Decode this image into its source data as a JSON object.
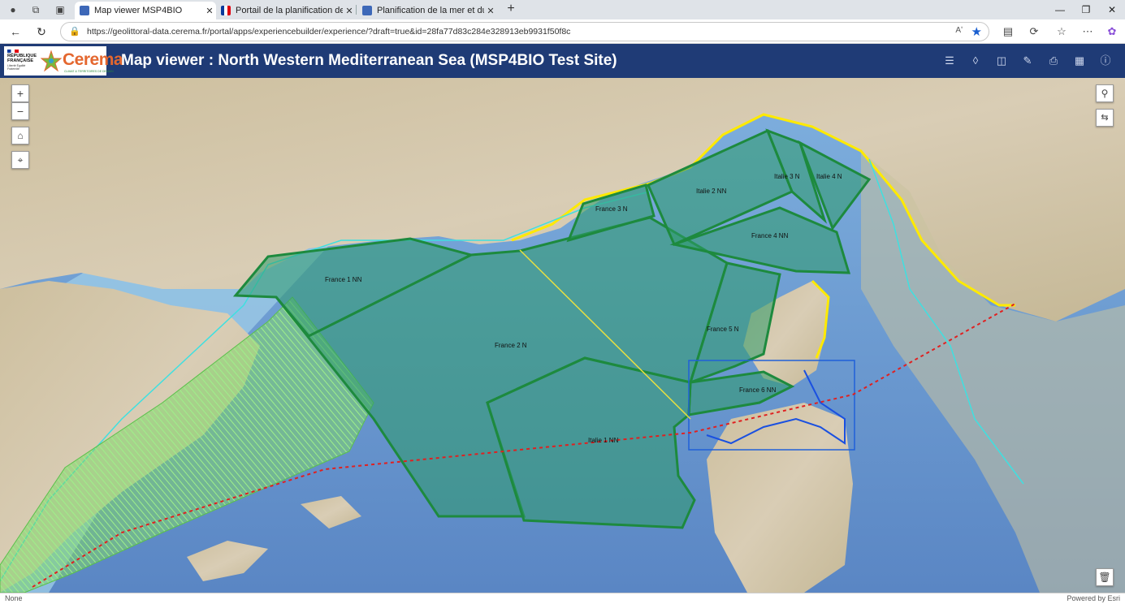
{
  "browser": {
    "tabs": [
      {
        "title": "Map viewer MSP4BIO",
        "active": true
      },
      {
        "title": "Portail de la planification de la mer",
        "active": false
      },
      {
        "title": "Planification de la mer et du littoral",
        "active": false
      }
    ],
    "url": "https://geolittoral-data.cerema.fr/portal/apps/experiencebuilder/experience/?draft=true&id=28fa77d83c284e328913eb9931f50f8c",
    "read_aloud": "Aʹ"
  },
  "logo": {
    "republique": "RÉPUBLIQUE FRANÇAISE",
    "republique_sub": "Liberté Égalité Fraternité",
    "cerema": "Cerema",
    "cerema_sub": "CLIMAT & TERRITOIRES DE DEMAIN"
  },
  "header": {
    "title": "Map viewer : North Western Mediterranean Sea (MSP4BIO Test Site)",
    "tools": [
      "list-icon",
      "layers-icon",
      "database-icon",
      "draw-icon",
      "print-icon",
      "grid-icon",
      "info-icon"
    ]
  },
  "map": {
    "controls": {
      "zoom_in": "+",
      "zoom_out": "−"
    },
    "zones": [
      {
        "label": "France 1 NN"
      },
      {
        "label": "France 2 N"
      },
      {
        "label": "France 3 N"
      },
      {
        "label": "Italie 2 NN"
      },
      {
        "label": "Italie 3 N"
      },
      {
        "label": "Italie 4 N"
      },
      {
        "label": "France 4 NN"
      },
      {
        "label": "France 5 N"
      },
      {
        "label": "France 6 NN"
      },
      {
        "label": "Italie 1 NN"
      }
    ],
    "colors": {
      "sea": "#6f9bd1",
      "land": "#d7c9b0",
      "zone_fill": "#2e9a6a",
      "zone_stroke": "#1d8a3e",
      "coast": "#ffea00",
      "ecuador_line": "#d02020"
    }
  },
  "status": {
    "left": "None",
    "right": "Powered by Esri"
  }
}
